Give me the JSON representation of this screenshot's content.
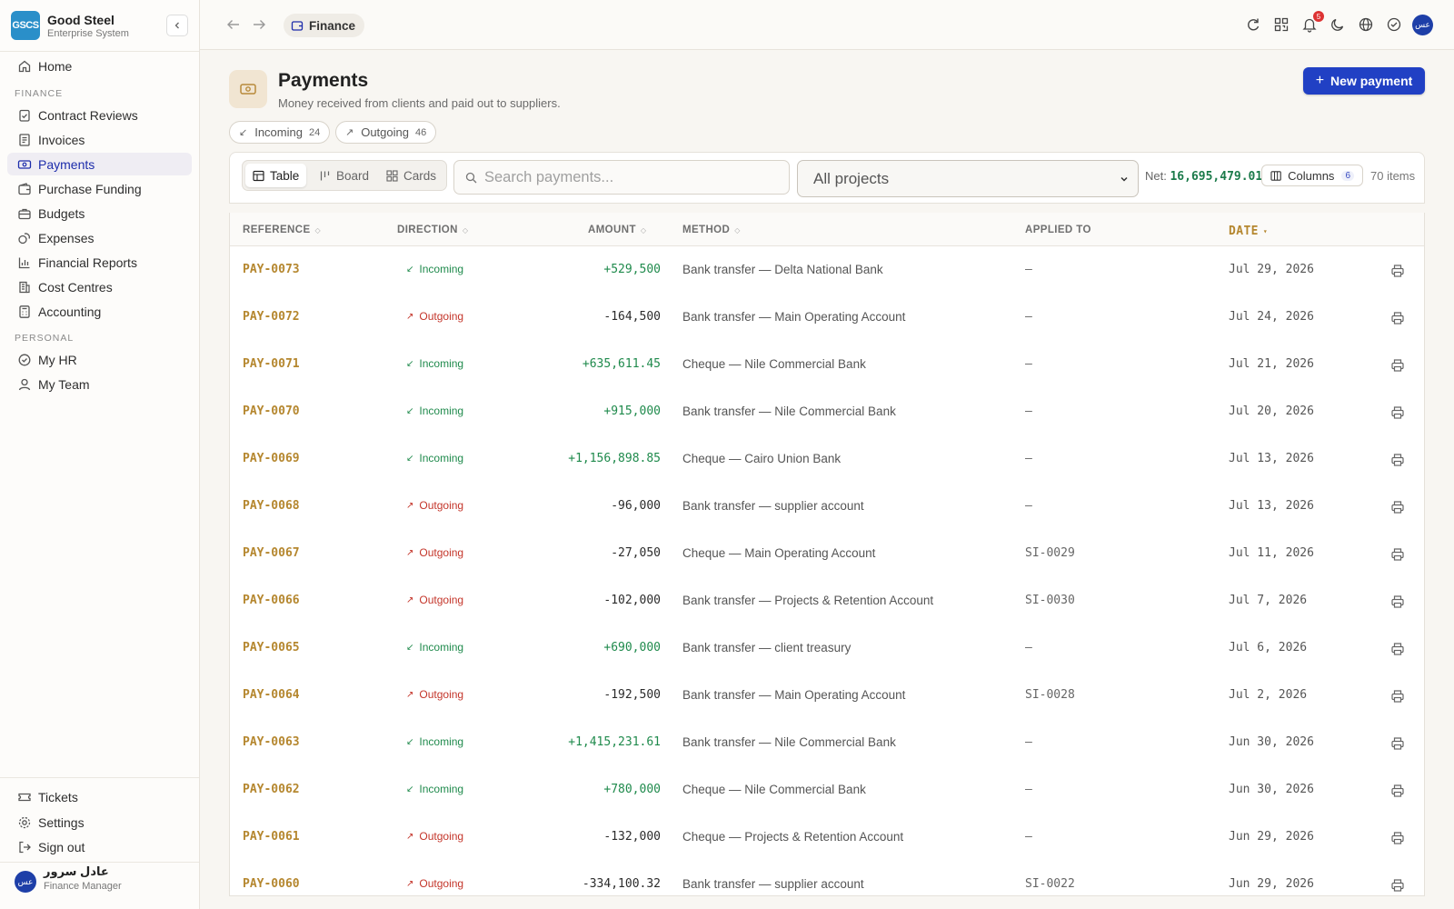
{
  "brand": {
    "logo": "GSCS",
    "name": "Good Steel",
    "subtitle": "Enterprise System"
  },
  "sidebar": {
    "home": "Home",
    "finance_section": "FINANCE",
    "finance_items": [
      {
        "label": "Contract Reviews",
        "icon": "clipboard-check-icon"
      },
      {
        "label": "Invoices",
        "icon": "receipt-icon"
      },
      {
        "label": "Payments",
        "icon": "banknote-icon",
        "active": true
      },
      {
        "label": "Purchase Funding",
        "icon": "wallet-icon"
      },
      {
        "label": "Budgets",
        "icon": "briefcase-icon"
      },
      {
        "label": "Expenses",
        "icon": "coins-icon"
      },
      {
        "label": "Financial Reports",
        "icon": "bar-chart-icon"
      },
      {
        "label": "Cost Centres",
        "icon": "building-icon"
      },
      {
        "label": "Accounting",
        "icon": "calculator-icon"
      }
    ],
    "personal_section": "PERSONAL",
    "personal_items": [
      {
        "label": "My HR",
        "icon": "check-circle-icon"
      },
      {
        "label": "My Team",
        "icon": "user-icon"
      }
    ],
    "footer_items": [
      {
        "label": "Tickets",
        "icon": "ticket-icon"
      },
      {
        "label": "Settings",
        "icon": "gear-icon"
      },
      {
        "label": "Sign out",
        "icon": "sign-out-icon"
      }
    ],
    "user": {
      "initials": "عس",
      "name": "عادل سرور",
      "role": "Finance Manager"
    }
  },
  "topbar": {
    "breadcrumb": "Finance",
    "notification_count": "5",
    "avatar_initials": "عس"
  },
  "header": {
    "title": "Payments",
    "subtitle": "Money received from clients and paid out to suppliers.",
    "new_button": "New payment"
  },
  "filters": {
    "incoming": {
      "label": "Incoming",
      "count": "24"
    },
    "outgoing": {
      "label": "Outgoing",
      "count": "46"
    }
  },
  "toolbar": {
    "views": [
      "Table",
      "Board",
      "Cards"
    ],
    "search_placeholder": "Search payments...",
    "project_select": "All projects",
    "net_label": "Net:",
    "net_value": "16,695,479.01",
    "columns_label": "Columns",
    "columns_count": "6",
    "items_count": "70 items"
  },
  "table": {
    "columns": [
      "REFERENCE",
      "DIRECTION",
      "AMOUNT",
      "METHOD",
      "APPLIED TO",
      "DATE"
    ],
    "rows": [
      {
        "ref": "PAY-0073",
        "direction": "Incoming",
        "amount": "+529,500",
        "method": "Bank transfer — Delta National Bank",
        "applied_to": "—",
        "date": "Jul 29, 2026"
      },
      {
        "ref": "PAY-0072",
        "direction": "Outgoing",
        "amount": "-164,500",
        "method": "Bank transfer — Main Operating Account",
        "applied_to": "—",
        "date": "Jul 24, 2026"
      },
      {
        "ref": "PAY-0071",
        "direction": "Incoming",
        "amount": "+635,611.45",
        "method": "Cheque — Nile Commercial Bank",
        "applied_to": "—",
        "date": "Jul 21, 2026"
      },
      {
        "ref": "PAY-0070",
        "direction": "Incoming",
        "amount": "+915,000",
        "method": "Bank transfer — Nile Commercial Bank",
        "applied_to": "—",
        "date": "Jul 20, 2026"
      },
      {
        "ref": "PAY-0069",
        "direction": "Incoming",
        "amount": "+1,156,898.85",
        "method": "Cheque — Cairo Union Bank",
        "applied_to": "—",
        "date": "Jul 13, 2026"
      },
      {
        "ref": "PAY-0068",
        "direction": "Outgoing",
        "amount": "-96,000",
        "method": "Bank transfer — supplier account",
        "applied_to": "—",
        "date": "Jul 13, 2026"
      },
      {
        "ref": "PAY-0067",
        "direction": "Outgoing",
        "amount": "-27,050",
        "method": "Cheque — Main Operating Account",
        "applied_to": "SI-0029",
        "date": "Jul 11, 2026"
      },
      {
        "ref": "PAY-0066",
        "direction": "Outgoing",
        "amount": "-102,000",
        "method": "Bank transfer — Projects & Retention Account",
        "applied_to": "SI-0030",
        "date": "Jul 7, 2026"
      },
      {
        "ref": "PAY-0065",
        "direction": "Incoming",
        "amount": "+690,000",
        "method": "Bank transfer — client treasury",
        "applied_to": "—",
        "date": "Jul 6, 2026"
      },
      {
        "ref": "PAY-0064",
        "direction": "Outgoing",
        "amount": "-192,500",
        "method": "Bank transfer — Main Operating Account",
        "applied_to": "SI-0028",
        "date": "Jul 2, 2026"
      },
      {
        "ref": "PAY-0063",
        "direction": "Incoming",
        "amount": "+1,415,231.61",
        "method": "Bank transfer — Nile Commercial Bank",
        "applied_to": "—",
        "date": "Jun 30, 2026"
      },
      {
        "ref": "PAY-0062",
        "direction": "Incoming",
        "amount": "+780,000",
        "method": "Cheque — Nile Commercial Bank",
        "applied_to": "—",
        "date": "Jun 30, 2026"
      },
      {
        "ref": "PAY-0061",
        "direction": "Outgoing",
        "amount": "-132,000",
        "method": "Cheque — Projects & Retention Account",
        "applied_to": "—",
        "date": "Jun 29, 2026"
      },
      {
        "ref": "PAY-0060",
        "direction": "Outgoing",
        "amount": "-334,100.32",
        "method": "Bank transfer — supplier account",
        "applied_to": "SI-0022",
        "date": "Jun 29, 2026"
      }
    ]
  },
  "colors": {
    "accent": "#2140c4",
    "brand": "#2a8fc9",
    "incoming": "#1f8a4c",
    "outgoing": "#c4352a",
    "reference": "#b5872f"
  }
}
